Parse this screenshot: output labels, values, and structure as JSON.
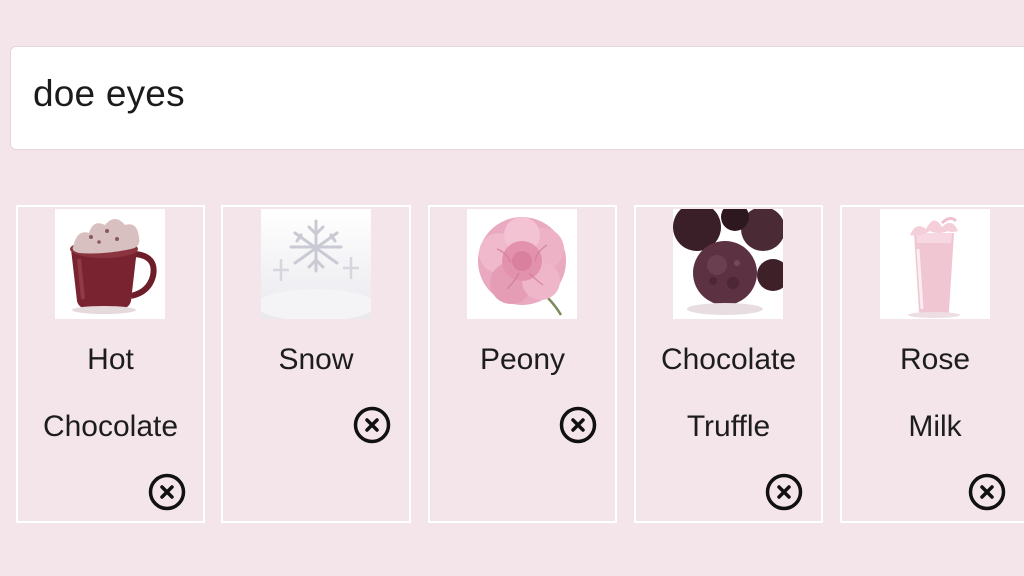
{
  "search": {
    "value": "doe eyes"
  },
  "cards": [
    {
      "line1": "Hot",
      "line2": "Chocolate",
      "image": "hot-chocolate-image",
      "remove_icon": "close-circle-icon"
    },
    {
      "line1": "Snow",
      "line2": "",
      "image": "snowflake-image",
      "remove_icon": "close-circle-icon"
    },
    {
      "line1": "Peony",
      "line2": "",
      "image": "peony-image",
      "remove_icon": "close-circle-icon"
    },
    {
      "line1": "Chocolate",
      "line2": "Truffle",
      "image": "chocolate-truffle-image",
      "remove_icon": "close-circle-icon"
    },
    {
      "line1": "Rose",
      "line2": "Milk",
      "image": "rose-milk-image",
      "remove_icon": "close-circle-icon"
    }
  ],
  "colors": {
    "background": "#f3e5e9",
    "text": "#1d1d1d",
    "card_border": "#ffffff"
  }
}
